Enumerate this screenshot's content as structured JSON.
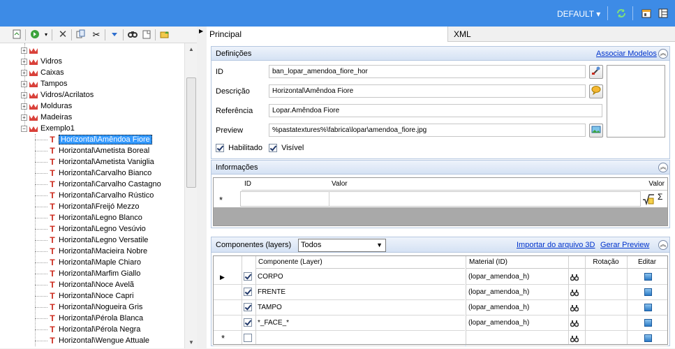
{
  "header": {
    "profile_label": "DEFAULT",
    "icons": [
      "refresh-icon",
      "settings-icon",
      "layout-icon"
    ]
  },
  "toolbar": {
    "icons": [
      "new-icon",
      "go-icon",
      "delete-icon",
      "copy-icon",
      "cut-icon",
      "move-down-icon",
      "find-icon",
      "paste-icon",
      "export-icon"
    ]
  },
  "tree": {
    "items": [
      {
        "label": "",
        "kind": "folder",
        "expanded": false
      },
      {
        "label": "Vidros",
        "kind": "folder",
        "expanded": false
      },
      {
        "label": "Caixas",
        "kind": "folder",
        "expanded": false
      },
      {
        "label": "Tampos",
        "kind": "folder",
        "expanded": false
      },
      {
        "label": "Vidros/Acrilatos",
        "kind": "folder",
        "expanded": false
      },
      {
        "label": "Molduras",
        "kind": "folder",
        "expanded": false
      },
      {
        "label": "Madeiras",
        "kind": "folder",
        "expanded": false
      },
      {
        "label": "Exemplo1",
        "kind": "folder",
        "expanded": true
      }
    ],
    "children": [
      "Horizontal\\Amêndoa Fiore",
      "Horizontal\\Ametista Boreal",
      "Horizontal\\Ametista Vaniglia",
      "Horizontal\\Carvalho Bianco",
      "Horizontal\\Carvalho Castagno",
      "Horizontal\\Carvalho Rústico",
      "Horizontal\\Freijó Mezzo",
      "Horizontal\\Legno Blanco",
      "Horizontal\\Legno Vesúvio",
      "Horizontal\\Legno Versatile",
      "Horizontal\\Macieira Nobre",
      "Horizontal\\Maple Chiaro",
      "Horizontal\\Marfim Giallo",
      "Horizontal\\Noce Avelã",
      "Horizontal\\Noce Capri",
      "Horizontal\\Nogueira Gris",
      "Horizontal\\Pérola Blanca",
      "Horizontal\\Pérola Negra",
      "Horizontal\\Wengue Attuale"
    ],
    "selected_index": 0
  },
  "tabs": [
    {
      "label": "Principal",
      "active": true
    },
    {
      "label": "XML",
      "active": false
    }
  ],
  "definicoes": {
    "title": "Definições",
    "link": "Associar Modelos",
    "id_label": "ID",
    "id_value": "ban_lopar_amendoa_fiore_hor",
    "descricao_label": "Descrição",
    "descricao_value": "Horizontal\\Amêndoa Fiore",
    "referencia_label": "Referência",
    "referencia_value": "Lopar.Amêndoa Fiore",
    "preview_label": "Preview",
    "preview_value": "%pastatextures%\\fabrica\\lopar\\amendoa_fiore.jpg",
    "habilitado_label": "Habilitado",
    "habilitado": true,
    "visivel_label": "Visível",
    "visivel": true
  },
  "informacoes": {
    "title": "Informações",
    "columns": [
      "ID",
      "Valor",
      "Valor"
    ],
    "new_row_marker": "*",
    "sigma": "Σ"
  },
  "componentes": {
    "title": "Componentes (layers)",
    "filter_value": "Todos",
    "import_link": "Importar do arquivo 3D",
    "preview_link": "Gerar Preview",
    "columns": [
      "Componente (Layer)",
      "Material (ID)",
      "Rotação",
      "Editar"
    ],
    "rows": [
      {
        "checked": true,
        "componente": "CORPO",
        "material": "(lopar_amendoa_h)",
        "current": true
      },
      {
        "checked": true,
        "componente": "FRENTE",
        "material": "(lopar_amendoa_h)",
        "current": false
      },
      {
        "checked": true,
        "componente": "TAMPO",
        "material": "(lopar_amendoa_h)",
        "current": false
      },
      {
        "checked": true,
        "componente": "*_FACE_*",
        "material": "(lopar_amendoa_h)",
        "current": false
      }
    ],
    "new_row_marker": "*"
  },
  "colors": {
    "header_bg": "#3d8be6",
    "selection": "#3399ff",
    "link": "#0033cc",
    "tree_icon": "#cc2a1c"
  }
}
